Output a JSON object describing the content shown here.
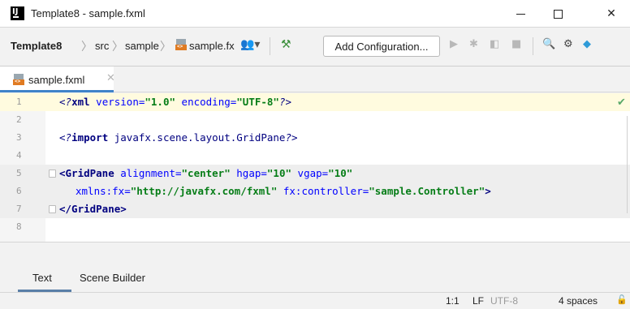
{
  "window": {
    "title": "Template8 - sample.fxml",
    "minimize_glyph": "",
    "maximize_glyph": "",
    "close_glyph": "✕"
  },
  "navbar": {
    "breadcrumbs": [
      {
        "label": "Template8",
        "bold": true
      },
      {
        "label": "src",
        "bold": false
      },
      {
        "label": "sample",
        "bold": false
      },
      {
        "label": "sample.fx",
        "bold": false
      }
    ],
    "separator": "〉",
    "add_configuration": "Add Configuration...",
    "icons": [
      "user-dropdown-icon",
      "hammer-icon",
      "run-icon",
      "debug-icon",
      "coverage-icon",
      "stop-icon",
      "search-icon",
      "gear-icon",
      "toolbox-icon"
    ]
  },
  "editor_tab": {
    "label": "sample.fxml",
    "close_glyph": "✕"
  },
  "editor": {
    "lines": [
      {
        "n": "1"
      },
      {
        "n": "2"
      },
      {
        "n": "3"
      },
      {
        "n": "4"
      },
      {
        "n": "5"
      },
      {
        "n": "6"
      },
      {
        "n": "7"
      },
      {
        "n": "8"
      }
    ],
    "code": {
      "l1_open": "<?",
      "l1_xml": "xml",
      "l1_version_attr": " version=",
      "l1_version_val": "\"1.0\"",
      "l1_encoding_attr": " encoding=",
      "l1_encoding_val": "\"UTF-8\"",
      "l1_close": "?>",
      "l3_open": "<?",
      "l3_import": "import",
      "l3_class": " javafx.scene.layout.GridPane",
      "l3_close": "?>",
      "l5_tag": "<GridPane",
      "l5_align_attr": " alignment=",
      "l5_align_val": "\"center\"",
      "l5_hgap_attr": " hgap=",
      "l5_hgap_val": "\"10\"",
      "l5_vgap_attr": " vgap=",
      "l5_vgap_val": "\"10\"",
      "l6_xmlns_attr": "xmlns:fx=",
      "l6_xmlns_val": "\"http://javafx.com/fxml\"",
      "l6_ctrl_attr": " fx:controller=",
      "l6_ctrl_val": "\"sample.Controller\"",
      "l6_end": ">",
      "l7_tag": "</GridPane",
      "l7_end": ">"
    },
    "check_glyph": "✔"
  },
  "bottom_tabs": [
    "Text",
    "Scene Builder"
  ],
  "status": {
    "position": "1:1",
    "line_separator": "LF",
    "encoding": "UTF-8",
    "indent": "4 spaces"
  },
  "colors": {
    "accent": "#4083c9",
    "tag": "#000080",
    "attribute": "#0000ff",
    "string": "#067d17",
    "current_line": "#fffbdf"
  }
}
